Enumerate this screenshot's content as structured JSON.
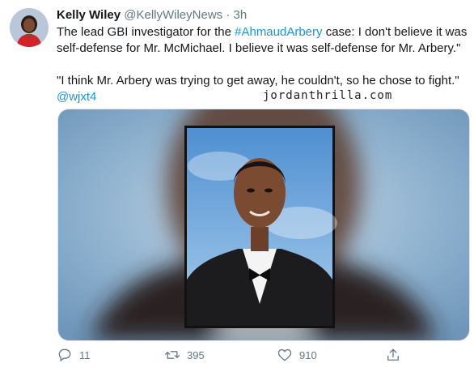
{
  "tweet": {
    "author_name": "Kelly Wiley",
    "author_handle": "@KellyWileyNews",
    "separator": "·",
    "timestamp": "3h",
    "text_part1": "The lead GBI investigator for the ",
    "hashtag": "#AhmaudArbery",
    "text_part2": " case: I don't believe it was self-defense for Mr. McMichael. I believe it was self-defense for Mr. Arbery.\"",
    "quote": "\"I think Mr. Arbery was trying to get away, he couldn't, so he chose to fight.\"",
    "mention": "@wjxt4",
    "watermark": "jordanthrilla.com",
    "replies": "11",
    "retweets": "395",
    "likes": "910"
  },
  "icons": {
    "reply": "reply-icon",
    "retweet": "retweet-icon",
    "like": "heart-icon",
    "share": "share-icon"
  },
  "colors": {
    "link": "#1b95e0",
    "secondary_text": "#657786"
  }
}
